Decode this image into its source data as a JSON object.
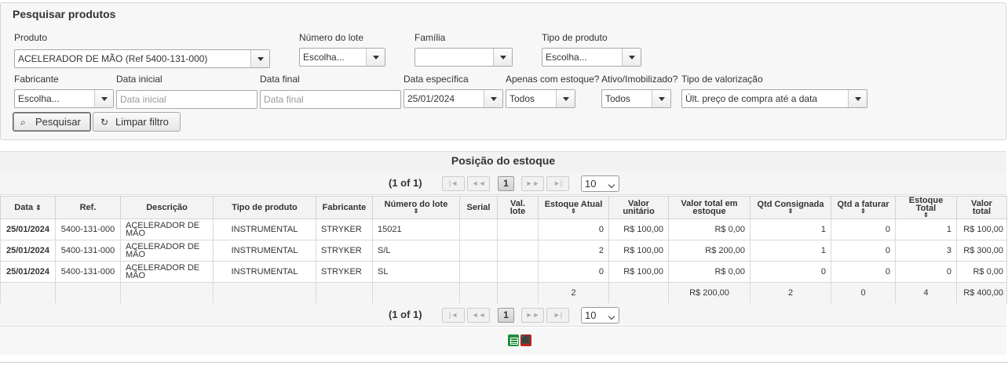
{
  "search": {
    "title": "Pesquisar produtos",
    "produto_label": "Produto",
    "produto_value": "ACELERADOR DE MÃO (Ref 5400-131-000)",
    "lote_label": "Número do lote",
    "lote_value": "Escolha...",
    "familia_label": "Família",
    "familia_value": "",
    "tipo_label": "Tipo de produto",
    "tipo_value": "Escolha...",
    "fabricante_label": "Fabricante",
    "fabricante_value": "Escolha...",
    "data_inicial_label": "Data inicial",
    "data_inicial_placeholder": "Data inicial",
    "data_final_label": "Data final",
    "data_final_placeholder": "Data final",
    "data_especifica_label": "Data específica",
    "data_especifica_value": "25/01/2024",
    "apenas_estoque_label": "Apenas com estoque?",
    "apenas_estoque_value": "Todos",
    "ativo_label": "Ativo/Imobilizado?",
    "ativo_value": "Todos",
    "valorizacao_label": "Tipo de valorização",
    "valorizacao_value": "Últ. preço de compra até a data",
    "pesquisar_label": "Pesquisar",
    "limpar_label": "Limpar filtro"
  },
  "stock": {
    "title": "Posição do estoque",
    "pager_info": "(1 of 1)",
    "current_page": "1",
    "rows_per_page": "10",
    "pager_icons": {
      "first": "|◄",
      "prev": "◄◄",
      "next": "►►",
      "last": "►|"
    },
    "columns": {
      "data": "Data",
      "ref": "Ref.",
      "descricao": "Descrição",
      "tipo": "Tipo de produto",
      "fabricante": "Fabricante",
      "lote": "Número do lote",
      "serial": "Serial",
      "val_lote_1": "Val.",
      "val_lote_2": "lote",
      "estoque_atual": "Estoque Atual",
      "valor_unit_1": "Valor",
      "valor_unit_2": "unitário",
      "valor_total_estoque_1": "Valor total em",
      "valor_total_estoque_2": "estoque",
      "qtd_consignada": "Qtd Consignada",
      "qtd_faturar": "Qtd a faturar",
      "estoque_total_1": "Estoque",
      "estoque_total_2": "Total",
      "valor_total_1": "Valor",
      "valor_total_2": "total"
    },
    "rows": [
      {
        "data": "25/01/2024",
        "ref": "5400-131-000",
        "descricao": "ACELERADOR DE MÃO",
        "tipo": "INSTRUMENTAL",
        "fabricante": "STRYKER",
        "lote": "15021",
        "serial": "",
        "val_lote": "",
        "estoque_atual": "0",
        "valor_unitario": "R$ 100,00",
        "valor_total_estoque": "R$ 0,00",
        "qtd_consignada": "1",
        "qtd_faturar": "0",
        "estoque_total": "1",
        "valor_total": "R$ 100,00"
      },
      {
        "data": "25/01/2024",
        "ref": "5400-131-000",
        "descricao": "ACELERADOR DE MÃO",
        "tipo": "INSTRUMENTAL",
        "fabricante": "STRYKER",
        "lote": "S/L",
        "serial": "",
        "val_lote": "",
        "estoque_atual": "2",
        "valor_unitario": "R$ 100,00",
        "valor_total_estoque": "R$ 200,00",
        "qtd_consignada": "1",
        "qtd_faturar": "0",
        "estoque_total": "3",
        "valor_total": "R$ 300,00"
      },
      {
        "data": "25/01/2024",
        "ref": "5400-131-000",
        "descricao": "ACELERADOR DE MÃO",
        "tipo": "INSTRUMENTAL",
        "fabricante": "STRYKER",
        "lote": "SL",
        "serial": "",
        "val_lote": "",
        "estoque_atual": "0",
        "valor_unitario": "R$ 100,00",
        "valor_total_estoque": "R$ 0,00",
        "qtd_consignada": "0",
        "qtd_faturar": "0",
        "estoque_total": "0",
        "valor_total": "R$ 0,00"
      }
    ],
    "totals": {
      "estoque_atual": "2",
      "valor_total_estoque": "R$ 200,00",
      "qtd_consignada": "2",
      "qtd_faturar": "0",
      "estoque_total": "4",
      "valor_total": "R$ 400,00"
    }
  },
  "exports": {
    "excel_icon": "excel-icon",
    "pdf_icon": "pdf-icon"
  }
}
